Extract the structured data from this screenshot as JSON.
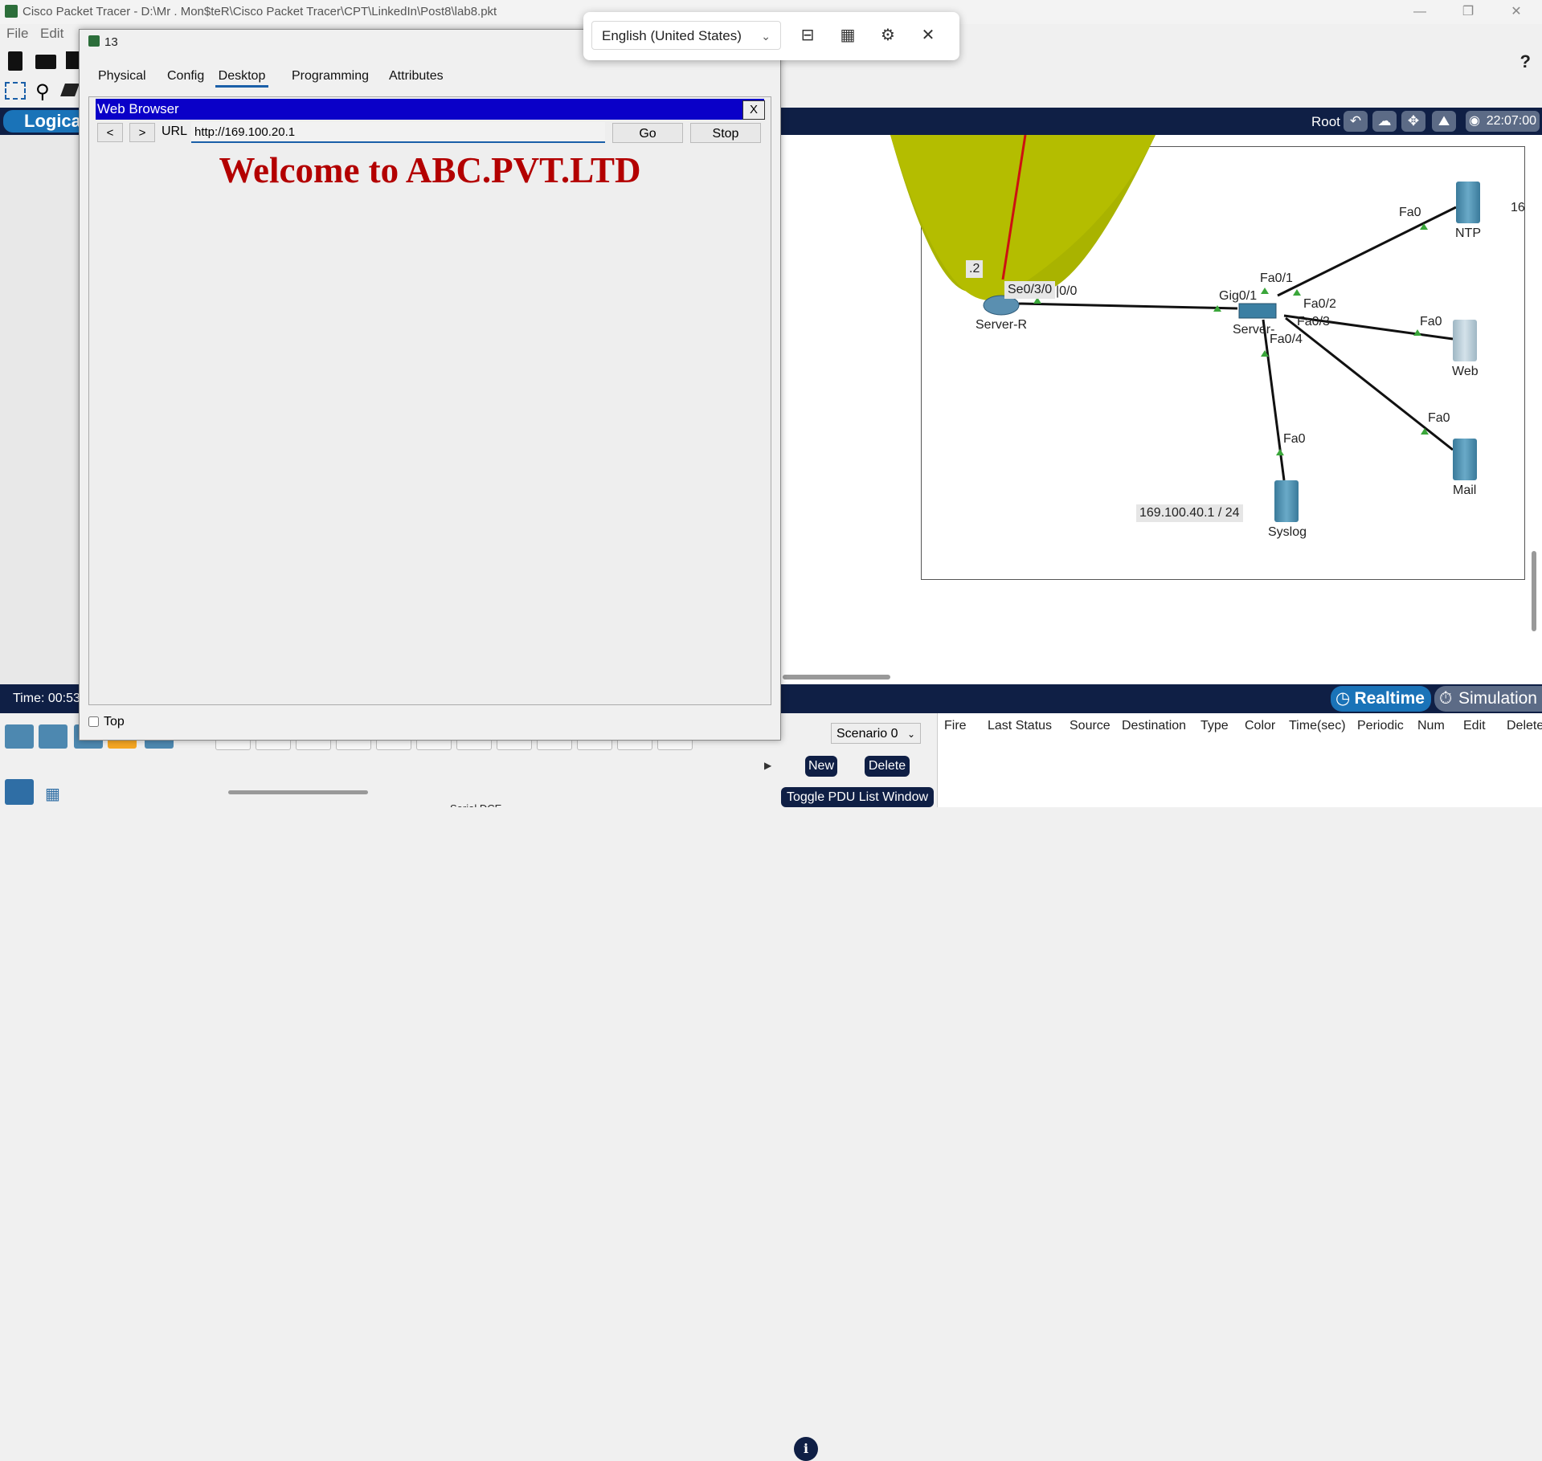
{
  "window": {
    "title": "Cisco Packet Tracer - D:\\Mr . Mon$teR\\Cisco Packet Tracer\\CPT\\LinkedIn\\Post8\\lab8.pkt"
  },
  "menu": {
    "file": "File",
    "edit": "Edit"
  },
  "toolbar": {
    "help": "?"
  },
  "logical_bar": {
    "label": "Logica",
    "root": "Root",
    "clock": "22:07:00"
  },
  "topology": {
    "labels": {
      "router_ip": ".2",
      "se_port": "Se0/3/0",
      "se_port_partial": "|0/0",
      "router_name": "Server-R",
      "gig_port": "Gig0/1",
      "switch_name": "Server-",
      "sw_fa01": "Fa0/1",
      "sw_fa02": "Fa0/2",
      "sw_fa03": "Fa0/3",
      "sw_fa04": "Fa0/4",
      "ntp_port": "Fa0",
      "ntp_name": "NTP",
      "web_port": "Fa0",
      "web_name": "Web",
      "mail_port": "Fa0",
      "mail_name": "Mail",
      "syslog_port": "Fa0",
      "syslog_name": "Syslog",
      "subnet": "169.100.40.1 / 24",
      "partial_16": "16"
    }
  },
  "dialog": {
    "title": "13",
    "tabs": [
      "Physical",
      "Config",
      "Desktop",
      "Programming",
      "Attributes"
    ],
    "active_tab": "Desktop",
    "web_browser": {
      "title": "Web Browser",
      "close": "X",
      "back": "<",
      "forward": ">",
      "url_label": "URL",
      "url": "http://169.100.20.1",
      "go": "Go",
      "stop": "Stop",
      "content_heading": "Welcome to ABC.PVT.LTD",
      "content_color": "#b30000"
    },
    "top_checkbox": "Top"
  },
  "language_popup": {
    "selected": "English (United States)"
  },
  "status": {
    "time": "Time: 00:53",
    "realtime": "Realtime",
    "simulation": "Simulation"
  },
  "pdu": {
    "scenario": "Scenario 0",
    "new": "New",
    "delete": "Delete",
    "toggle": "Toggle PDU List Window",
    "columns": [
      "Fire",
      "Last Status",
      "Source",
      "Destination",
      "Type",
      "Color",
      "Time(sec)",
      "Periodic",
      "Num",
      "Edit",
      "Delete"
    ]
  },
  "bottom": {
    "cable_label": "Serial DCE"
  },
  "colors": {
    "accent_blue": "#1a73b8",
    "dark_navy": "#0f1f45",
    "browser_title": "#0a00c8",
    "cluster_yellow": "#a9b300"
  }
}
